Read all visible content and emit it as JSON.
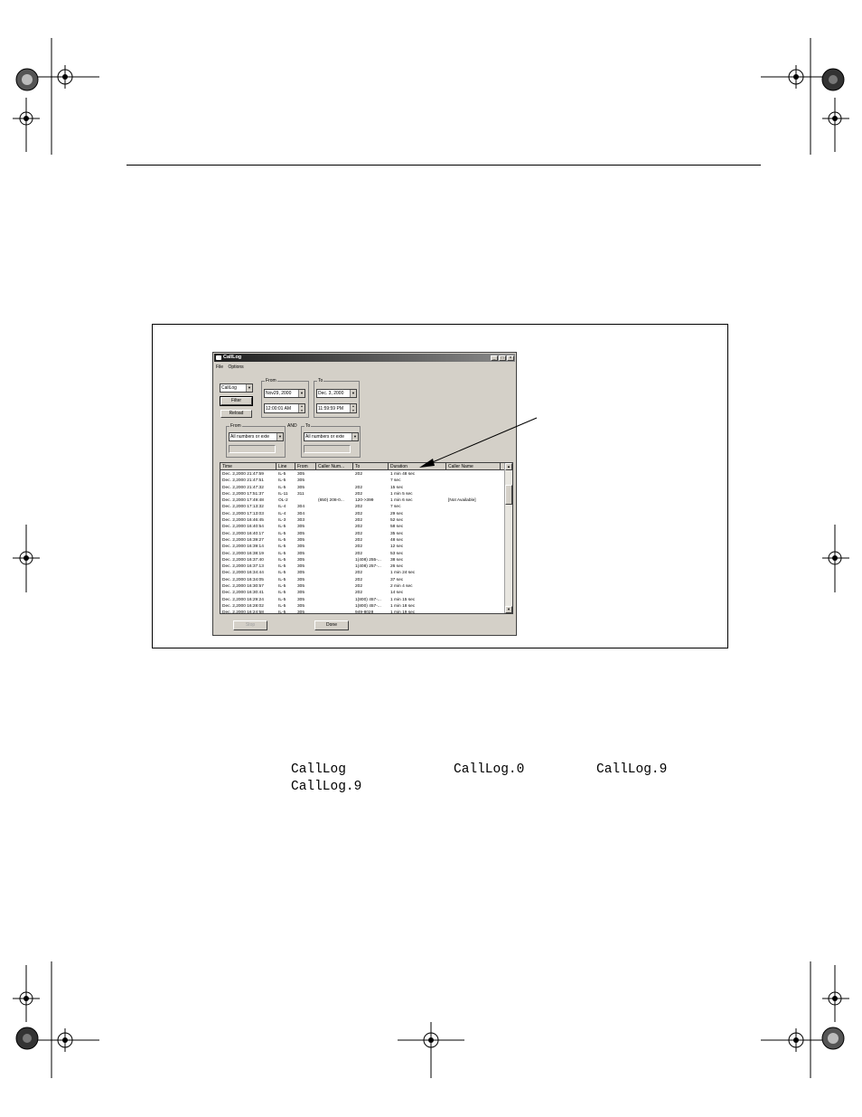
{
  "window": {
    "title": "CallLog",
    "menu": [
      "File",
      "Options"
    ],
    "log_select": "CallLog",
    "filter_label": "Filter",
    "reload_label": "Reload",
    "from_label": "From",
    "to_label": "To",
    "from_date": "Nov29, 2000",
    "from_time": "12:00:01 AM",
    "to_date": "Dec. 3, 2000",
    "to_time": "11:59:59 PM",
    "and_label": "AND",
    "numbers_from_label": "From",
    "numbers_to_label": "To",
    "numbers_from_value": "All numbers or exte",
    "numbers_to_value": "All numbers or exte",
    "stop_label": "Stop",
    "done_label": "Done",
    "minimize_symbol": "_",
    "maximize_symbol": "□",
    "close_symbol": "×",
    "scroll_up_symbol": "▲",
    "scroll_down_symbol": "▼",
    "dropdown_symbol": "▼"
  },
  "table": {
    "columns": [
      "Time",
      "Line",
      "From",
      "Caller Num...",
      "To",
      "Duration",
      "Caller Name"
    ],
    "rows": [
      [
        "Dec. 2,2000 21:47:59",
        "IL-5",
        "305",
        "",
        "202",
        "1 min 48 sec",
        ""
      ],
      [
        "Dec. 2,2000 21:47:51",
        "IL-5",
        "305",
        "",
        "",
        "7 sec",
        ""
      ],
      [
        "Dec. 2,2000 21:47:32",
        "IL-5",
        "305",
        "",
        "202",
        "15 sec",
        ""
      ],
      [
        "Dec. 2,2000 17:51:37",
        "IL-11",
        "311",
        "",
        "202",
        "1 min 5 sec",
        ""
      ],
      [
        "Dec. 2,2000 17:49:48",
        "OL-2",
        "",
        "(650) 208-0...",
        "120->399",
        "1 min 6 sec",
        "[Not Available]"
      ],
      [
        "Dec. 2,2000 17:13:32",
        "IL-4",
        "304",
        "",
        "202",
        "7 sec",
        ""
      ],
      [
        "Dec. 2,2000 17:13:03",
        "IL-4",
        "304",
        "",
        "202",
        "29 sec",
        ""
      ],
      [
        "Dec. 2,2000 16:46:45",
        "IL-3",
        "303",
        "",
        "202",
        "52 sec",
        ""
      ],
      [
        "Dec. 2,2000 16:40:54",
        "IL-5",
        "305",
        "",
        "202",
        "58 sec",
        ""
      ],
      [
        "Dec. 2,2000 16:40:17",
        "IL-5",
        "305",
        "",
        "202",
        "35 sec",
        ""
      ],
      [
        "Dec. 2,2000 16:39:27",
        "IL-5",
        "305",
        "",
        "202",
        "48 sec",
        ""
      ],
      [
        "Dec. 2,2000 16:39:14",
        "IL-5",
        "305",
        "",
        "202",
        "12 sec",
        ""
      ],
      [
        "Dec. 2,2000 16:38:19",
        "IL-5",
        "305",
        "",
        "202",
        "53 sec",
        ""
      ],
      [
        "Dec. 2,2000 16:37:40",
        "IL-5",
        "305",
        "",
        "1(408) 255-...",
        "38 sec",
        ""
      ],
      [
        "Dec. 2,2000 16:37:13",
        "IL-5",
        "305",
        "",
        "1(408) 257-...",
        "26 sec",
        ""
      ],
      [
        "Dec. 2,2000 16:34:44",
        "IL-5",
        "305",
        "",
        "202",
        "1 min 24 sec",
        ""
      ],
      [
        "Dec. 2,2000 16:34:05",
        "IL-5",
        "305",
        "",
        "202",
        "37 sec",
        ""
      ],
      [
        "Dec. 2,2000 16:30:57",
        "IL-5",
        "305",
        "",
        "202",
        "2 min 4 sec",
        ""
      ],
      [
        "Dec. 2,2000 16:30:41",
        "IL-5",
        "305",
        "",
        "202",
        "14 sec",
        ""
      ],
      [
        "Dec. 2,2000 16:29:24",
        "IL-5",
        "305",
        "",
        "1(800) 457-...",
        "1 min 15 sec",
        ""
      ],
      [
        "Dec. 2,2000 16:28:02",
        "IL-5",
        "305",
        "",
        "1(800) 457-...",
        "1 min 18 sec",
        ""
      ],
      [
        "Dec. 2,2000 16:24:58",
        "IL-5",
        "305",
        "",
        "949-8028",
        "1 min 19 sec",
        ""
      ]
    ]
  },
  "body_text": {
    "file1": "CallLog",
    "file2": "CallLog.0",
    "file3": "CallLog.9",
    "file4": "CallLog.9"
  }
}
